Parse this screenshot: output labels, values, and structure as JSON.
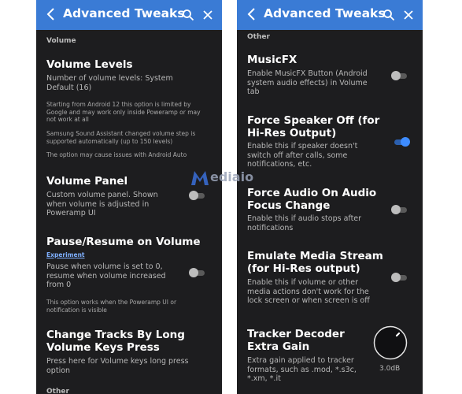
{
  "left_screen": {
    "title": "Advanced Tweaks",
    "section": "Volume",
    "volume_levels": {
      "title": "Volume Levels",
      "summary": "Number of volume levels: System Default (16)",
      "notes": [
        "Starting from Android 12 this option is limited by Google and may work only inside Poweramp or may not work at all",
        "Samsung Sound Assistant changed volume step is supported automatically (up to 150 levels)",
        "The option may cause issues with Android Auto"
      ]
    },
    "volume_panel": {
      "title": "Volume Panel",
      "summary": "Custom volume panel. Shown when volume is adjusted in Poweramp UI",
      "enabled": false
    },
    "pause_resume": {
      "title": "Pause/Resume on Volume",
      "badge": "Experiment",
      "summary": "Pause when volume is set to 0, resume when volume increased from 0",
      "note": "This option works when the Poweramp UI or notification is visible",
      "enabled": false
    },
    "change_tracks": {
      "title": "Change Tracks By Long Volume Keys Press",
      "summary": "Press here for Volume keys long press option"
    },
    "next_section": "Other"
  },
  "right_screen": {
    "title": "Advanced Tweaks",
    "section": "Other",
    "musicfx": {
      "title": "MusicFX",
      "summary": "Enable MusicFX Button (Android system audio effects) in Volume tab",
      "enabled": false
    },
    "force_speaker": {
      "title": "Force Speaker Off (for Hi-Res Output)",
      "summary": "Enable this if speaker doesn't switch off after calls, some notifications, etc.",
      "enabled": true
    },
    "force_audio_focus": {
      "title": "Force Audio On Audio Focus Change",
      "summary": "Enable this if audio stops after notifications",
      "enabled": false
    },
    "emulate_media": {
      "title": "Emulate Media Stream (for Hi-Res output)",
      "summary": "Enable this if volume or other media actions don't work for the lock screen or when screen is off",
      "enabled": false
    },
    "tracker_gain": {
      "title": "Tracker Decoder Extra Gain",
      "summary": "Extra gain applied to tracker formats, such as .mod, *.s3c, *.xm, *.it",
      "value": "3.0dB"
    }
  },
  "watermark": "ediaio",
  "colors": {
    "appbar": "#3a7bd5",
    "panel_bg": "#1d1d1f",
    "switch_on": "#3e8cff",
    "accent_link": "#7fb0ff"
  },
  "icons": {
    "back": "chevron-left-icon",
    "search": "search-icon",
    "close": "close-icon",
    "knob": "rotary-knob-icon"
  }
}
